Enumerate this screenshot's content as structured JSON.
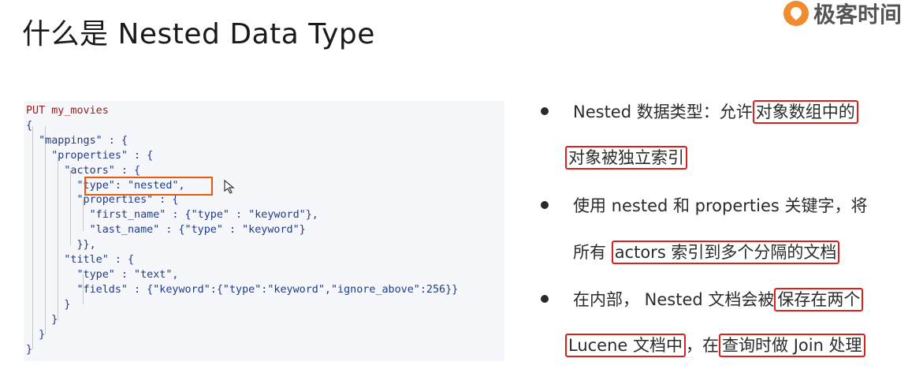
{
  "slide": {
    "title": "什么是 Nested Data Type"
  },
  "logo": {
    "text": "极客时间",
    "accent": "#f28a2e"
  },
  "code": {
    "lines": [
      "PUT my_movies",
      "{",
      "  \"mappings\" : {",
      "    \"properties\" : {",
      "      \"actors\" : {",
      "        \"type\": \"nested\",",
      "        \"properties\" : {",
      "          \"first_name\" : {\"type\" : \"keyword\"},",
      "          \"last_name\" : {\"type\" : \"keyword\"}",
      "        }},",
      "      \"title\" : {",
      "        \"type\" : \"text\",",
      "        \"fields\" : {\"keyword\":{\"type\":\"keyword\",\"ignore_above\":256}}",
      "      }",
      "    }",
      "  }",
      "}"
    ],
    "highlight_color": "#e8590c"
  },
  "bullets": [
    {
      "line1": {
        "plain": "Nested 数据类型：允许",
        "boxed": "对象数组中的"
      },
      "line2": {
        "boxed": "对象被独立索引"
      }
    },
    {
      "line1": {
        "plain": "使用 nested 和 properties 关键字，将"
      },
      "line2": {
        "plain": "所有 ",
        "boxed": "actors 索引到多个分隔的文档"
      }
    },
    {
      "line1": {
        "plain": "在内部， Nested 文档会被",
        "boxed": "保存在两个"
      },
      "line2": {
        "boxed_a": "Lucene 文档中",
        "plain": "，在",
        "boxed_b": "查询时做 Join 处理"
      }
    }
  ],
  "box_color": "#d92020"
}
